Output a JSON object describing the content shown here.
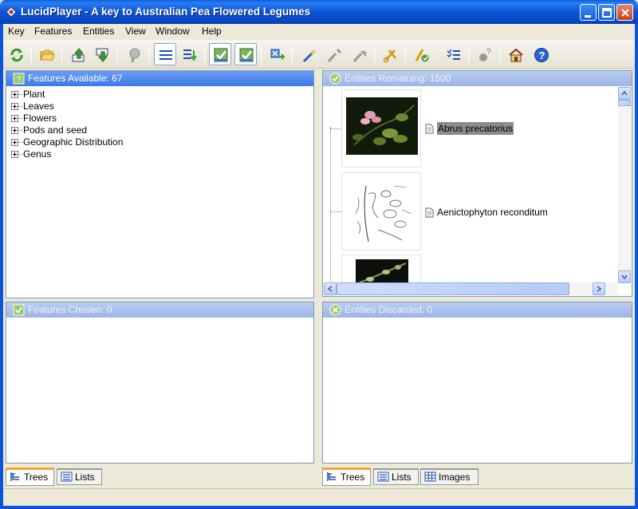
{
  "window": {
    "title": "LucidPlayer - A key to Australian Pea Flowered Legumes"
  },
  "menu": [
    {
      "label": "Key"
    },
    {
      "label": "Features"
    },
    {
      "label": "Entities"
    },
    {
      "label": "View"
    },
    {
      "label": "Window"
    },
    {
      "label": "Help"
    }
  ],
  "toolbar": {
    "icons": [
      "restart-icon",
      "open-folder-icon",
      "move-up-icon",
      "move-down-icon",
      "find-icon",
      "list-view-icon",
      "sort-list-icon",
      "check-image-icon",
      "check-image-icon-2",
      "next-step-icon",
      "magic-wand-icon",
      "best-icon",
      "prune-icon",
      "scissors-icon",
      "differences-icon",
      "checklist-icon",
      "help-cursor-icon",
      "home-icon",
      "help-icon"
    ]
  },
  "features_available": {
    "title": "Features Available: 67",
    "items": [
      "Plant",
      "Leaves",
      "Flowers",
      "Pods and seed",
      "Geographic Distribution",
      "Genus"
    ]
  },
  "features_chosen": {
    "title": "Features Chosen: 0"
  },
  "entities_remaining": {
    "title": "Entities Remaining: 1500",
    "items": [
      "Abrus precatorius",
      "Aenictophyton reconditum"
    ]
  },
  "entities_discarded": {
    "title": "Entities Discarded: 0"
  },
  "left_tabs": [
    "Trees",
    "Lists"
  ],
  "right_tabs": [
    "Trees",
    "Lists",
    "Images"
  ],
  "colors": {
    "title_bar": "#0b55d8",
    "panel_header_active": "#3d79e8",
    "panel_header_inactive": "#9cb6e3",
    "tab_accent": "#f3a52f"
  }
}
